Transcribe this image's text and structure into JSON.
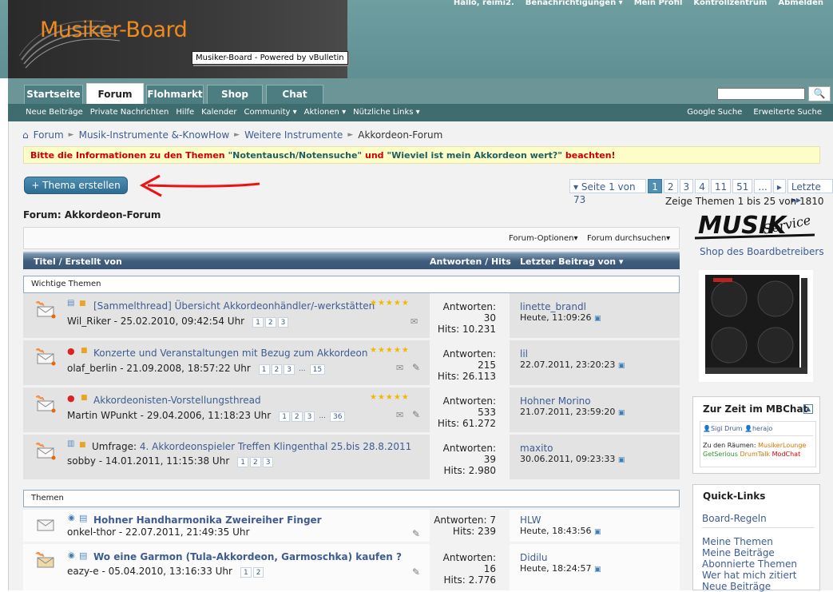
{
  "header": {
    "logo": "Musiker-Board",
    "tooltip": "Musiker-Board - Powered by vBulletin",
    "toplinks": [
      "Hallo, reimi2.",
      "Benachrichtigungen ▾",
      "Mein Profil",
      "Kontrollzentrum",
      "Abmelden"
    ]
  },
  "tabs": [
    "Startseite",
    "Forum",
    "Flohmarkt",
    "Shop",
    "Chat"
  ],
  "search": {
    "button": "🔍"
  },
  "subnav": {
    "items": [
      "Neue Beiträge",
      "Private Nachrichten",
      "Hilfe",
      "Kalender",
      "Community ▾",
      "Aktionen ▾",
      "Nützliche Links ▾"
    ],
    "right": [
      "Google Suche",
      "Erweiterte Suche"
    ]
  },
  "breadcrumb": [
    "Forum",
    "Musik-Instrumente &-KnowHow",
    "Weitere Instrumente",
    "Akkordeon-Forum"
  ],
  "notice": {
    "prefix": "Bitte die Informationen zu den Themen ",
    "link1": "\"Notentausch/Notensuche\"",
    "mid": " und ",
    "link2": "\"Wieviel ist mein Akkordeon wert?\"",
    "suffix": " beachten!"
  },
  "new_thread": "+ Thema erstellen",
  "pagination": {
    "label": "▾ Seite 1 von 73",
    "pages": [
      "1",
      "2",
      "3",
      "4",
      "11",
      "51",
      "...",
      "▸"
    ],
    "last": "Letzte ▸▸",
    "showing": "Zeige Themen 1 bis 25 von 1810"
  },
  "forum_title": "Forum: Akkordeon-Forum",
  "options": {
    "forum_options": "Forum-Optionen▾",
    "forum_search": "Forum durchsuchen▾"
  },
  "columns": {
    "title": "Titel / Erstellt von",
    "replies": "Antworten / Hits",
    "last": "Letzter Beitrag von ▾"
  },
  "sections": {
    "important": "Wichtige Themen",
    "threads": "Themen"
  },
  "sticky": [
    {
      "title": "[Sammelthread] Übersicht Akkordeonhändler/-werkstätten",
      "author": "Wil_Riker - 25.02.2010, 09:42:54 Uhr",
      "pages": [
        "1",
        "2",
        "3"
      ],
      "replies_label": "Antworten:",
      "replies": "30",
      "hits": "Hits: 10.231",
      "last_user": "linette_brandl",
      "last_time": "Heute, 11:09:26"
    },
    {
      "title": "Konzerte und Veranstaltungen mit Bezug zum Akkordeon",
      "author": "olaf_berlin - 21.09.2008, 18:57:22 Uhr",
      "pages": [
        "1",
        "2",
        "3",
        "...",
        "15"
      ],
      "replies_label": "Antworten:",
      "replies": "215",
      "hits": "Hits: 26.113",
      "last_user": "lil",
      "last_time": "22.07.2011, 23:20:23"
    },
    {
      "title": "Akkordeonisten-Vorstellungsthread",
      "author": "Martin WPunkt - 29.04.2006, 11:18:23 Uhr",
      "pages": [
        "1",
        "2",
        "3",
        "...",
        "36"
      ],
      "replies_label": "Antworten:",
      "replies": "533",
      "hits": "Hits: 61.272",
      "last_user": "Hohner Morino",
      "last_time": "21.07.2011, 23:59:20"
    },
    {
      "prefix": "Umfrage: ",
      "title": "4. Akkordeonspieler Treffen Klingenthal 25.bis 28.8.2011",
      "author": "sobby - 14.01.2011, 11:15:38 Uhr",
      "pages": [
        "1",
        "2",
        "3"
      ],
      "replies_label": "Antworten:",
      "replies": "39",
      "hits": "Hits: 2.980",
      "last_user": "maxito",
      "last_time": "30.06.2011, 09:23:33"
    }
  ],
  "threads": [
    {
      "title": "Hohner Handharmonika Zweireiher Finger",
      "author": "onkel-thor - 22.07.2011, 21:49:35 Uhr",
      "replies": "Antworten: 7",
      "hits": "Hits: 239",
      "last_user": "HLW",
      "last_time": "Heute, 18:43:56"
    },
    {
      "title": "Wo eine Garmon (Tula-Akkordeon, Garmoschka) kaufen ?",
      "author": "eazy-e - 05.04.2010, 13:16:33 Uhr",
      "pages": [
        "1",
        "2"
      ],
      "replies_label": "Antworten:",
      "replies": "16",
      "hits": "Hits: 2.776",
      "last_user": "Didilu",
      "last_time": "Heute, 18:24:57"
    }
  ],
  "sidebar": {
    "ad_logo": "MUSIK SERVICE",
    "shop": "Shop des Boardbetreibers",
    "chat_title": "Zur Zeit im MBChat",
    "chat_users": [
      "Sigi Drum",
      "herajo"
    ],
    "rooms_label": "Zu den Räumen:",
    "rooms": [
      "MusikerLounge",
      "GetSerious",
      "DrumTalk",
      "ModChat"
    ],
    "quick_title": "Quick-Links",
    "quick_first": "Board-Regeln",
    "quick_links": [
      "Meine Themen",
      "Meine Beiträge",
      "Abonnierte Themen",
      "Wer hat mich zitiert",
      "Neue Beiträge"
    ]
  },
  "colors": {
    "header": "#6e9ea0",
    "subnav": "#3f6c6f",
    "accent": "#4f8fb3",
    "notice": "#cc0000"
  }
}
